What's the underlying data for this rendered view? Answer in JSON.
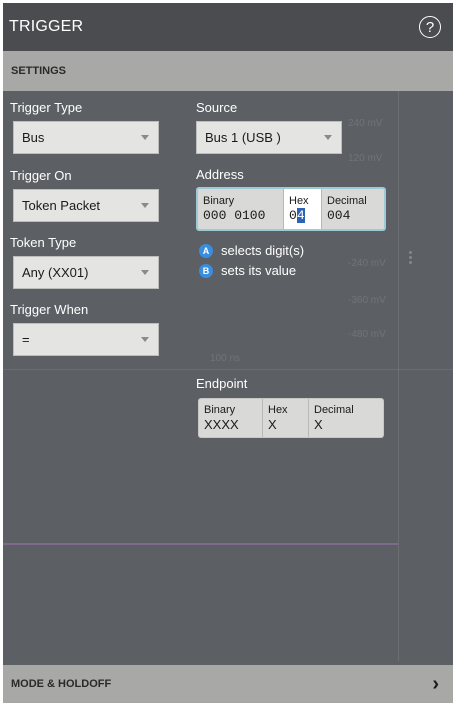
{
  "header": {
    "title": "TRIGGER",
    "help_icon": "?"
  },
  "sections": {
    "settings": "SETTINGS",
    "mode_holdoff": "MODE & HOLDOFF"
  },
  "trigger_type": {
    "label": "Trigger Type",
    "value": "Bus"
  },
  "trigger_on": {
    "label": "Trigger On",
    "value": "Token Packet"
  },
  "token_type": {
    "label": "Token Type",
    "value": "Any (XX01)"
  },
  "trigger_when": {
    "label": "Trigger When",
    "value": "="
  },
  "source": {
    "label": "Source",
    "value": "Bus 1 (USB )"
  },
  "address": {
    "label": "Address",
    "binary_label": "Binary",
    "binary_value": "000 0100",
    "hex_label": "Hex",
    "hex_value_first": "0",
    "hex_value_cursor": "4",
    "decimal_label": "Decimal",
    "decimal_value": "004"
  },
  "hints": {
    "a_badge": "A",
    "a_text": "selects digit(s)",
    "b_badge": "B",
    "b_text": "sets its value"
  },
  "endpoint": {
    "label": "Endpoint",
    "binary_label": "Binary",
    "binary_value": "XXXX",
    "hex_label": "Hex",
    "hex_value": "X",
    "decimal_label": "Decimal",
    "decimal_value": "X"
  },
  "colors": {
    "accent_focus": "#9dcad6",
    "cursor": "#2d63b5",
    "badge": "#3a8ee0",
    "trace": "#8a6b9a"
  }
}
